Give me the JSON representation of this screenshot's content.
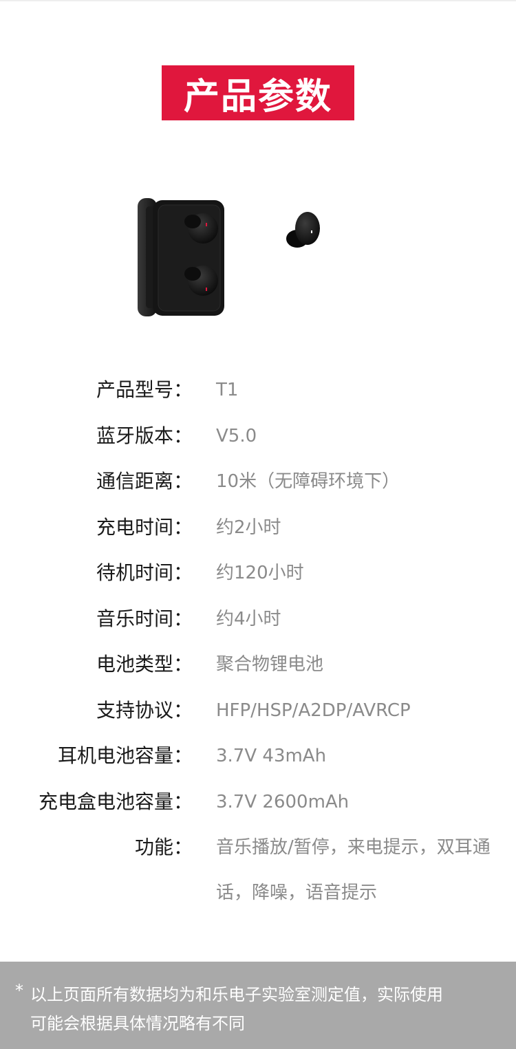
{
  "header": {
    "title": "产品参数"
  },
  "product_image": {
    "alt": ""
  },
  "specs": [
    {
      "label": "产品型号：",
      "value": "T1"
    },
    {
      "label": "蓝牙版本：",
      "value": "V5.0"
    },
    {
      "label": "通信距离：",
      "value": "10米（无障碍环境下）"
    },
    {
      "label": "充电时间：",
      "value": "约2小时"
    },
    {
      "label": "待机时间：",
      "value": "约120小时"
    },
    {
      "label": "音乐时间：",
      "value": "约4小时"
    },
    {
      "label": "电池类型：",
      "value": "聚合物锂电池"
    },
    {
      "label": "支持协议：",
      "value": "HFP/HSP/A2DP/AVRCP"
    },
    {
      "label": "耳机电池容量：",
      "value": "3.7V 43mAh"
    },
    {
      "label": "充电盒电池容量：",
      "value": "3.7V 2600mAh"
    },
    {
      "label": "功能：",
      "value": "音乐播放/暂停，来电提示，双耳通话，降噪，语音提示"
    }
  ],
  "footer": {
    "star": "*",
    "line1": "以上页面所有数据均为和乐电子实验室测定值，实际使用",
    "line2": "可能会根据具体情况略有不同"
  },
  "colors": {
    "accent": "#e0173d",
    "footer_bg": "#a9a9a9"
  }
}
